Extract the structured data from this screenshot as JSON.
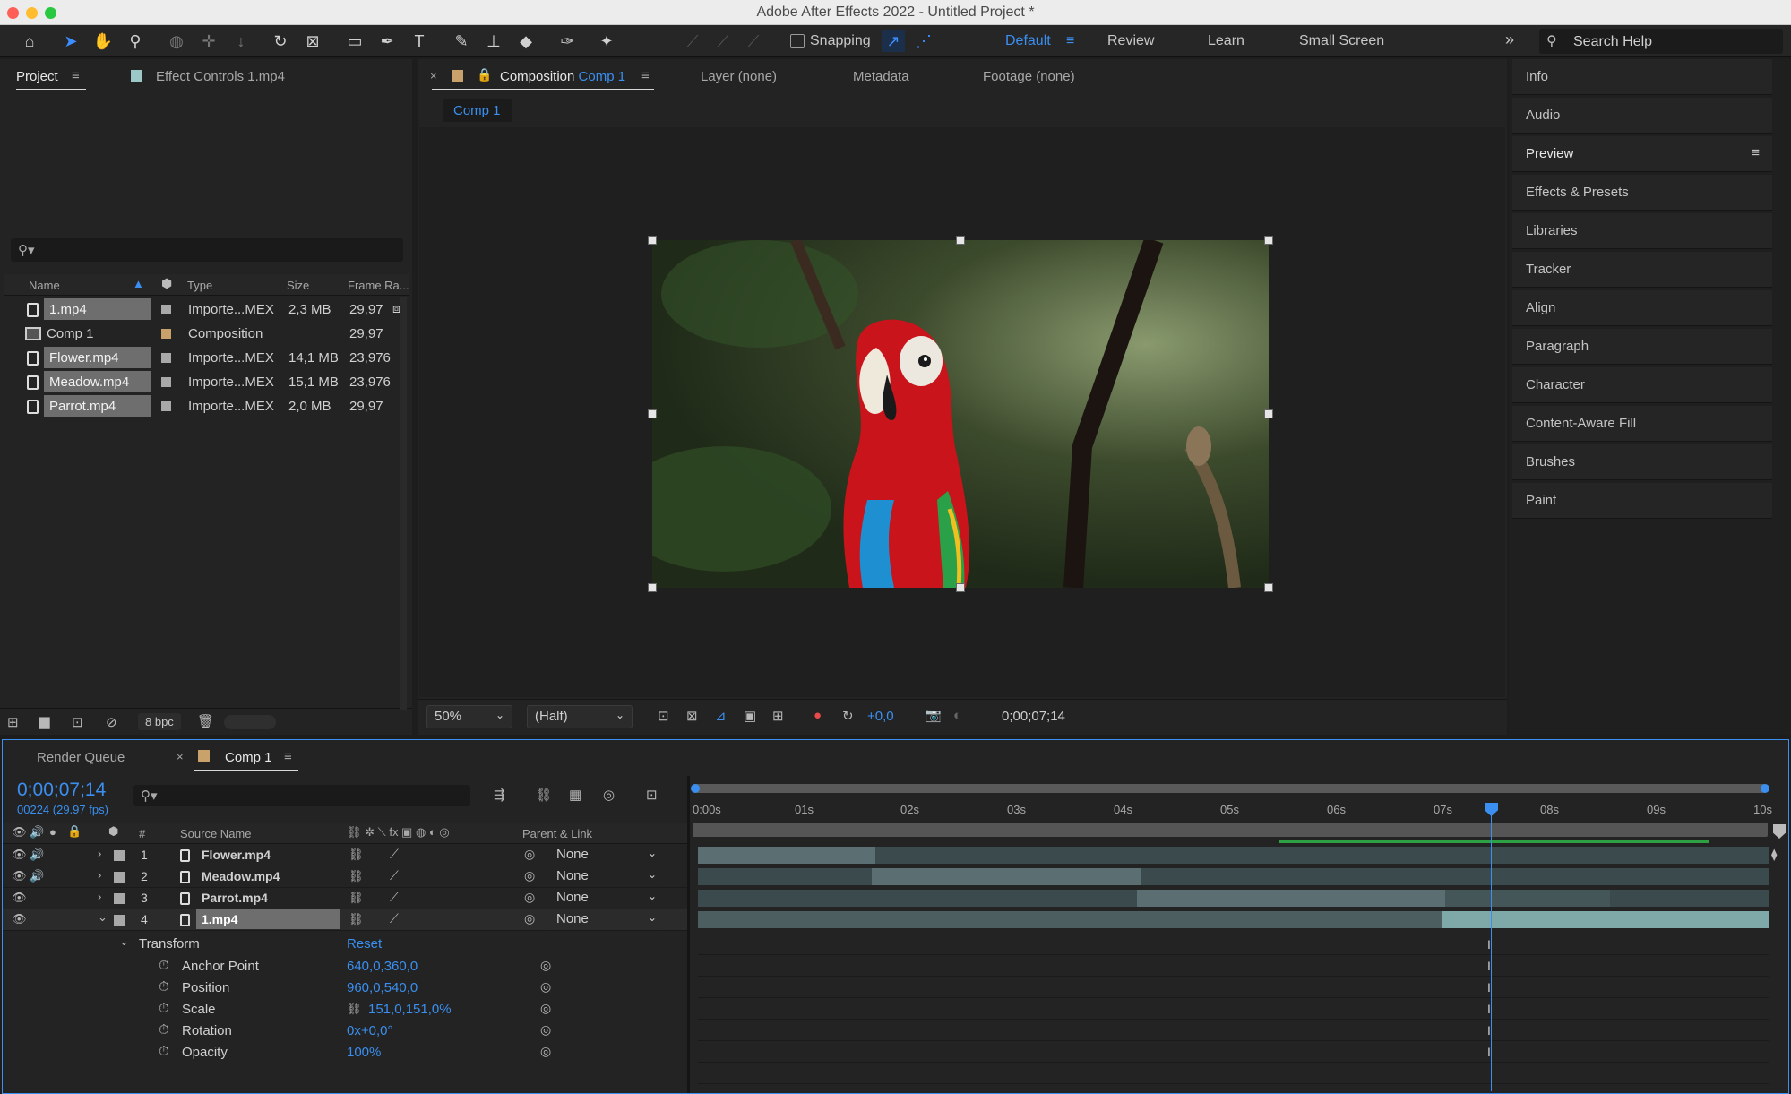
{
  "window": {
    "title": "Adobe After Effects 2022 - Untitled Project *"
  },
  "toolbar": {
    "snapping_label": "Snapping",
    "workspaces": [
      "Default",
      "Review",
      "Learn",
      "Small Screen"
    ],
    "active_workspace": "Default",
    "search_placeholder": "Search Help"
  },
  "project_panel": {
    "tab_project": "Project",
    "tab_effect_controls": "Effect Controls 1.mp4",
    "columns": [
      "Name",
      "Type",
      "Size",
      "Frame Ra..."
    ],
    "items": [
      {
        "name": "1.mp4",
        "type": "Importe...MEX",
        "size": "2,3 MB",
        "fps": "29,97",
        "label_color": "#a9a9a9"
      },
      {
        "name": "Comp 1",
        "type": "Composition",
        "size": "",
        "fps": "29,97",
        "label_color": "#c9a26b"
      },
      {
        "name": "Flower.mp4",
        "type": "Importe...MEX",
        "size": "14,1 MB",
        "fps": "23,976",
        "label_color": "#a9a9a9"
      },
      {
        "name": "Meadow.mp4",
        "type": "Importe...MEX",
        "size": "15,1 MB",
        "fps": "23,976",
        "label_color": "#a9a9a9"
      },
      {
        "name": "Parrot.mp4",
        "type": "Importe...MEX",
        "size": "2,0 MB",
        "fps": "29,97",
        "label_color": "#a9a9a9"
      }
    ],
    "bpc": "8 bpc"
  },
  "composition_panel": {
    "tab_label": "Composition",
    "comp_name": "Comp 1",
    "other_tabs": [
      "Layer (none)",
      "Metadata",
      "Footage (none)"
    ],
    "breadcrumb": "Comp 1",
    "zoom": "50%",
    "resolution": "(Half)",
    "exposure": "+0,0",
    "timecode": "0;00;07;14"
  },
  "side_panels": [
    "Info",
    "Audio",
    "Preview",
    "Effects & Presets",
    "Libraries",
    "Tracker",
    "Align",
    "Paragraph",
    "Character",
    "Content-Aware Fill",
    "Brushes",
    "Paint"
  ],
  "timeline": {
    "tab_render_queue": "Render Queue",
    "tab_comp": "Comp 1",
    "timecode": "0;00;07;14",
    "frame_info": "00224 (29.97 fps)",
    "col_source_name": "Source Name",
    "col_num": "#",
    "col_parent": "Parent & Link",
    "layers": [
      {
        "num": "1",
        "name": "Flower.mp4",
        "parent": "None"
      },
      {
        "num": "2",
        "name": "Meadow.mp4",
        "parent": "None"
      },
      {
        "num": "3",
        "name": "Parrot.mp4",
        "parent": "None"
      },
      {
        "num": "4",
        "name": "1.mp4",
        "parent": "None"
      }
    ],
    "transform_label": "Transform",
    "reset_label": "Reset",
    "properties": [
      {
        "name": "Anchor Point",
        "value": "640,0,360,0"
      },
      {
        "name": "Position",
        "value": "960,0,540,0"
      },
      {
        "name": "Scale",
        "value": "151,0,151,0%"
      },
      {
        "name": "Rotation",
        "value": "0x+0,0°"
      },
      {
        "name": "Opacity",
        "value": "100%"
      }
    ],
    "ruler": [
      "0:00s",
      "01s",
      "02s",
      "03s",
      "04s",
      "05s",
      "06s",
      "07s",
      "08s",
      "09s",
      "10s"
    ]
  },
  "colors": {
    "accent": "#3a8ff0",
    "panel": "#232323",
    "layer_bar": "#5b6f72",
    "active_bar": "#7fa8a8"
  }
}
